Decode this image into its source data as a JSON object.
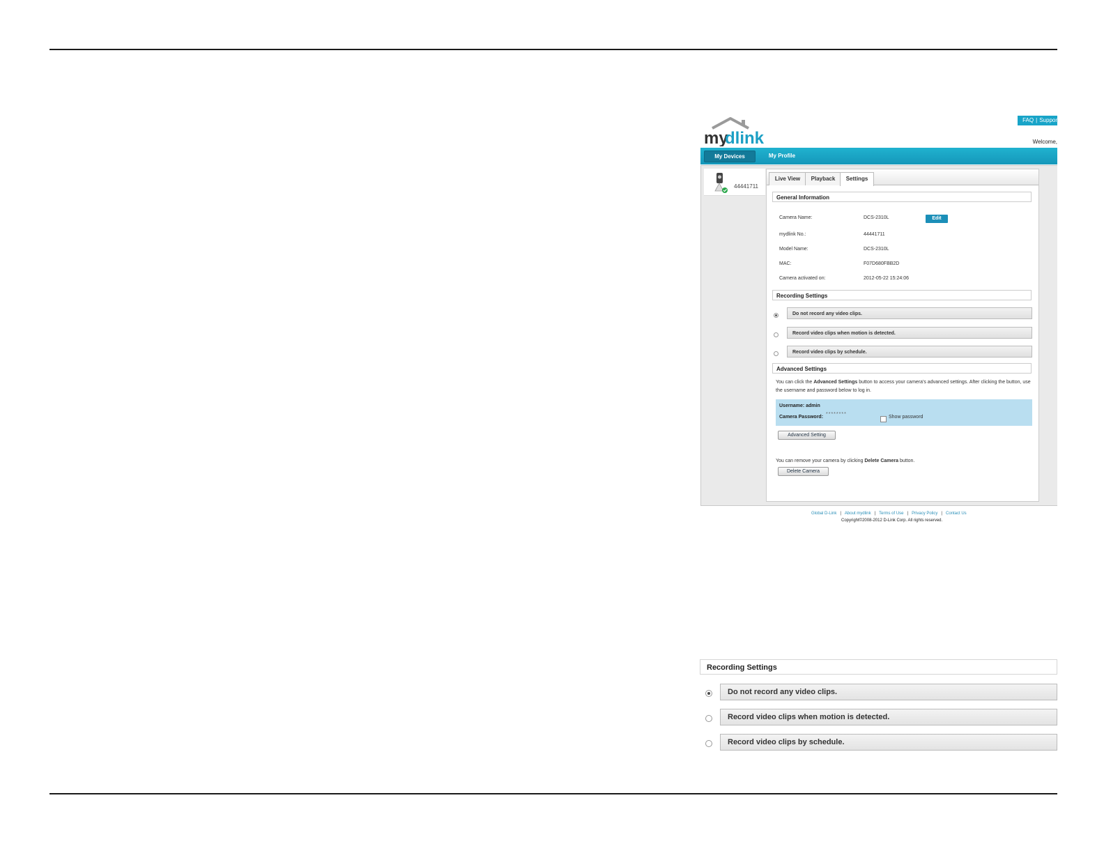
{
  "header": {
    "faq": "FAQ",
    "support": "Suppor",
    "welcome": "Welcome,"
  },
  "logo": {
    "prefix": "my",
    "suffix": "dlink"
  },
  "nav": {
    "my_devices": "My Devices",
    "my_profile": "My Profile"
  },
  "device": {
    "id": "44441711"
  },
  "tabs": [
    "Live View",
    "Playback",
    "Settings"
  ],
  "general": {
    "title": "General Information",
    "rows": [
      {
        "label": "Camera Name:",
        "value": "DCS-2310L"
      },
      {
        "label": "mydlink No.:",
        "value": "44441711"
      },
      {
        "label": "Model Name:",
        "value": "DCS-2310L"
      },
      {
        "label": "MAC:",
        "value": "F07D680FBB2D"
      },
      {
        "label": "Camera activated on:",
        "value": "2012-05-22 15:24:06"
      }
    ],
    "edit_label": "Edit"
  },
  "recording": {
    "title": "Recording Settings",
    "options": [
      "Do not record any video clips.",
      "Record video clips when motion is detected.",
      "Record video clips by schedule."
    ],
    "selected": 0
  },
  "advanced": {
    "title": "Advanced Settings",
    "text_1": "You can click the ",
    "text_bold": "Advanced Settings",
    "text_2": " button to access your camera's advanced settings. After clicking the button, use the username and password below to log in.",
    "username": "Username: admin",
    "password_label": "Camera Password:",
    "password_value": "********",
    "show_password": "Show password",
    "button": "Advanced Setting"
  },
  "delete": {
    "text_1": "You can remove your camera by clicking ",
    "text_bold": "Delete Camera",
    "text_2": " button.",
    "button": "Delete Camera"
  },
  "footer": {
    "links": [
      "Global D-Link",
      "About mydlink",
      "Terms of Use",
      "Privacy Policy",
      "Contact Us"
    ],
    "copyright": "Copyright©2008-2012 D-Link Corp. All rights reserved."
  },
  "colors": {
    "accent": "#1b9fc4",
    "highlight": "#b9def0"
  }
}
